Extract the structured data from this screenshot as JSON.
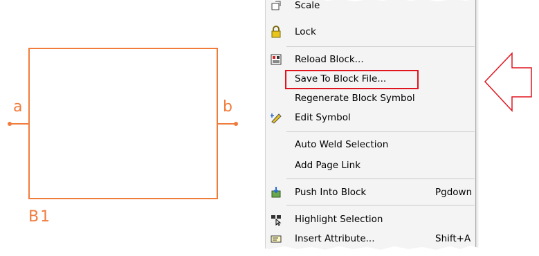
{
  "schematic": {
    "port_left_label": "a",
    "port_right_label": "b",
    "block_name": "B1",
    "color": "#f07c3c"
  },
  "menu": {
    "items": [
      {
        "label": "Scale",
        "shortcut": "",
        "icon": "scale-icon"
      },
      {
        "label": "Lock",
        "shortcut": "",
        "icon": "lock-icon"
      },
      {
        "label": "Reload Block...",
        "shortcut": "",
        "icon": "reload-block-icon"
      },
      {
        "label": "Save To Block File...",
        "shortcut": "",
        "icon": ""
      },
      {
        "label": "Regenerate Block Symbol",
        "shortcut": "",
        "icon": ""
      },
      {
        "label": "Edit Symbol",
        "shortcut": "",
        "icon": "edit-symbol-icon"
      },
      {
        "label": "Auto Weld Selection",
        "shortcut": "",
        "icon": ""
      },
      {
        "label": "Add Page Link",
        "shortcut": "",
        "icon": ""
      },
      {
        "label": "Push Into Block",
        "shortcut": "Pgdown",
        "icon": "push-into-block-icon"
      },
      {
        "label": "Highlight Selection",
        "shortcut": "",
        "icon": "highlight-selection-icon"
      },
      {
        "label": "Insert Attribute...",
        "shortcut": "Shift+A",
        "icon": "insert-attribute-icon"
      }
    ]
  },
  "annotation": {
    "highlight_color": "#e0141e",
    "arrow_color": "#e0141e"
  }
}
